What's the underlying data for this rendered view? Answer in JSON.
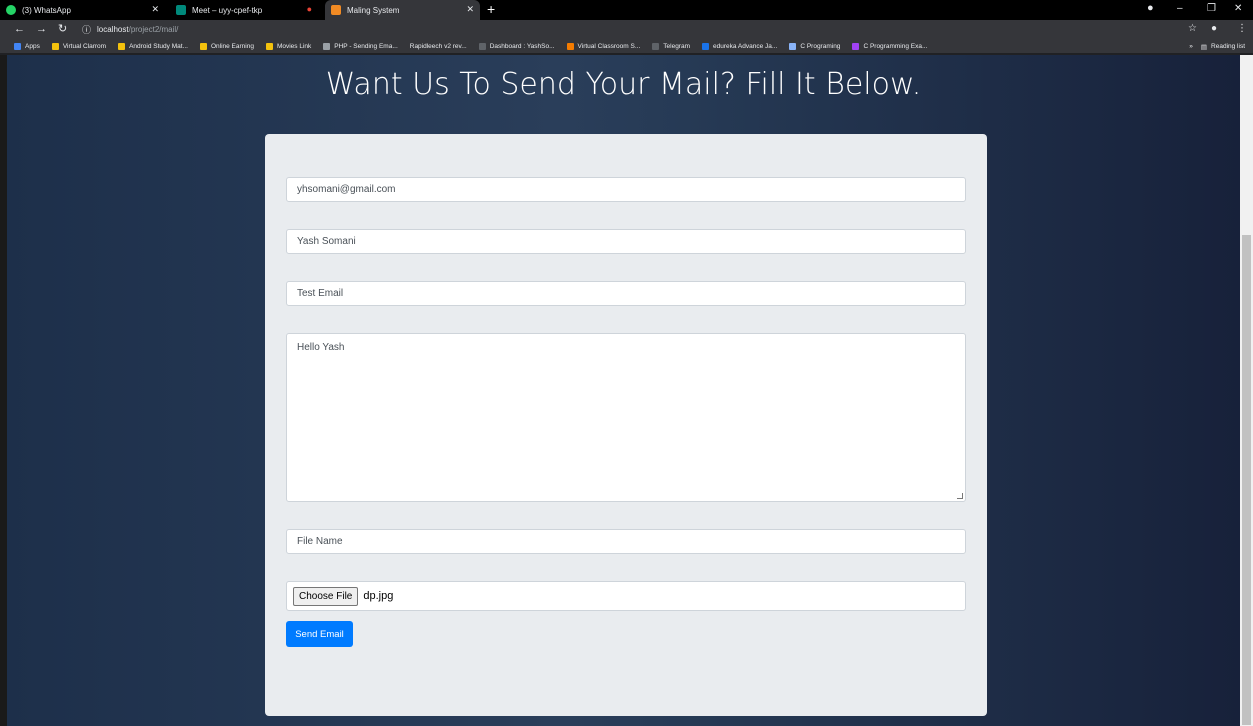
{
  "browser": {
    "tabs": [
      {
        "label": "(3) WhatsApp",
        "color": "#25d366"
      },
      {
        "label": "Meet – uyy-cpef-tkp",
        "color": "#00897b"
      },
      {
        "label": "Maling System",
        "color": "#f28b24"
      }
    ],
    "url_host": "localhost",
    "url_path": "/project2/mail/",
    "bookmarks": [
      {
        "label": "Apps",
        "color": "#4285f4"
      },
      {
        "label": "Virtual Clarrom",
        "color": "#f4c20d"
      },
      {
        "label": "Android Study Mat...",
        "color": "#f4c20d"
      },
      {
        "label": "Online Earning",
        "color": "#f4c20d"
      },
      {
        "label": "Movies Link",
        "color": "#f4c20d"
      },
      {
        "label": "PHP - Sending Ema...",
        "color": "#9aa0a6"
      },
      {
        "label": "Rapidleech v2 rev...",
        "color": "#35363a"
      },
      {
        "label": "Dashboard : YashSo...",
        "color": "#5f6368"
      },
      {
        "label": "Virtual Classroom S...",
        "color": "#f57c00"
      },
      {
        "label": "Telegram",
        "color": "#5f6368"
      },
      {
        "label": "edureka Advance Ja...",
        "color": "#1a73e8"
      },
      {
        "label": "C Programing",
        "color": "#8ab4f8"
      },
      {
        "label": "C Programming Exa...",
        "color": "#a142f4"
      }
    ],
    "overflow": "»",
    "reading_list": "Reading list"
  },
  "page": {
    "heading": "Want Us To Send Your Mail? Fill It Below.",
    "email_value": "yhsomani@gmail.com",
    "name_value": "Yash Somani",
    "subject_value": "Test Email",
    "message_value": "Hello Yash",
    "filename_placeholder": "File Name",
    "choose_file_label": "Choose File",
    "chosen_file": "dp.jpg",
    "send_label": "Send Email"
  }
}
